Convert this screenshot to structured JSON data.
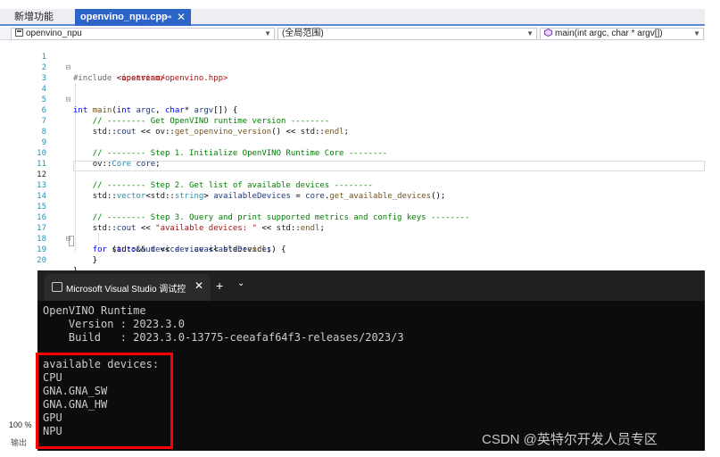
{
  "tabs": {
    "inactive_label": "新增功能",
    "active_label": "openvino_npu.cpp",
    "pin_glyph": "⊸",
    "close_glyph": "✕"
  },
  "navbar": {
    "project": "openvino_npu",
    "scope": "(全局范围)",
    "function": "main(int argc, char * argv[])"
  },
  "editor": {
    "line_numbers": [
      "1",
      "2",
      "3",
      "4",
      "5",
      "6",
      "7",
      "8",
      "9",
      "10",
      "11",
      "12",
      "13",
      "14",
      "15",
      "16",
      "17",
      "18",
      "19",
      "20"
    ],
    "current_line": "12"
  },
  "status": {
    "zoom": "100 %",
    "output_label": "输出"
  },
  "terminal": {
    "tab_title": "Microsoft Visual Studio 调试控",
    "close_glyph": "✕",
    "new_tab_glyph": "+",
    "dropdown_glyph": "⌄",
    "lines": [
      "OpenVINO Runtime",
      "    Version : 2023.3.0",
      "    Build   : 2023.3.0-13775-ceeafaf64f3-releases/2023/3",
      "",
      "available devices:",
      "CPU",
      "GNA.GNA_SW",
      "GNA.GNA_HW",
      "GPU",
      "NPU"
    ]
  },
  "watermark": "CSDN @英特尔开发人员专区",
  "colors": {
    "accent": "#2d64c8",
    "terminal_bg": "#0c0c0c",
    "highlight_box": "#ff0000"
  }
}
